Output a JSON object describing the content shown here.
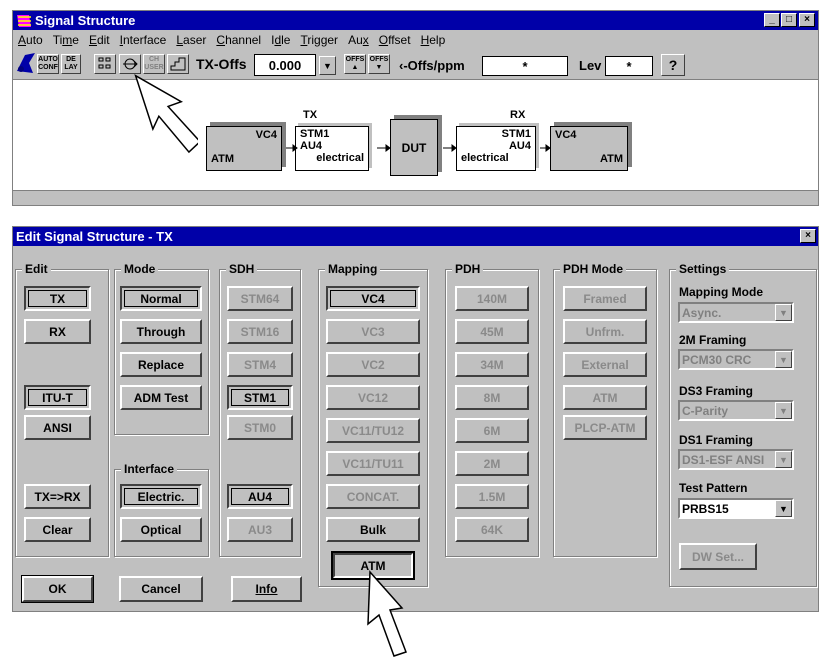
{
  "main_window": {
    "title": "Signal Structure",
    "min_btn": "_",
    "max_btn": "□",
    "close_btn": "×",
    "menu": [
      {
        "label": "Auto",
        "u": "A"
      },
      {
        "label": "Time",
        "u": "m"
      },
      {
        "label": "Edit",
        "u": "E"
      },
      {
        "label": "Interface",
        "u": "I"
      },
      {
        "label": "Laser",
        "u": "L"
      },
      {
        "label": "Channel",
        "u": "C"
      },
      {
        "label": "Idle",
        "u": "d"
      },
      {
        "label": "Trigger",
        "u": "T"
      },
      {
        "label": "Aux",
        "u": "x"
      },
      {
        "label": "Offset",
        "u": "O"
      },
      {
        "label": "Help",
        "u": "H"
      }
    ],
    "toolbar": {
      "auto_conf": "AUTO CONF",
      "delay": "DE LAY",
      "user_ch": "CH USER",
      "tx_offs_label": "TX-Offs",
      "tx_offs_value": "0.000",
      "offs_up": "OFFS ▲",
      "offs_down": "OFFS ▼",
      "offs_ppm_label": "‹-Offs/ppm",
      "offs_ppm_value": "*",
      "lev_label": "Lev",
      "lev_value": "*",
      "help_icon": "?"
    },
    "diagram": {
      "tx_label": "TX",
      "rx_label": "RX",
      "tx_atm": {
        "top": "VC4",
        "bottom": "ATM"
      },
      "tx_stm": {
        "l1": "STM1",
        "l2": "AU4",
        "l3": "electrical"
      },
      "dut": "DUT",
      "rx_stm": {
        "l1": "STM1",
        "l2": "AU4",
        "l3": "electrical"
      },
      "rx_atm": {
        "top": "VC4",
        "bottom": "ATM"
      }
    }
  },
  "dialog": {
    "title": "Edit Signal Structure - TX",
    "close": "×",
    "groups": {
      "edit": "Edit",
      "mode": "Mode",
      "sdh": "SDH",
      "mapping": "Mapping",
      "pdh": "PDH",
      "pdh_mode": "PDH Mode",
      "settings": "Settings",
      "interface": "Interface"
    },
    "edit": {
      "tx": "TX",
      "rx": "RX",
      "itu": "ITU-T",
      "ansi": "ANSI",
      "txrx": "TX=>RX",
      "clear": "Clear"
    },
    "mode": {
      "normal": "Normal",
      "through": "Through",
      "replace": "Replace",
      "adm": "ADM Test"
    },
    "interface": {
      "electric": "Electric.",
      "optical": "Optical"
    },
    "sdh": {
      "stm64": "STM64",
      "stm16": "STM16",
      "stm4": "STM4",
      "stm1": "STM1",
      "stm0": "STM0",
      "au4": "AU4",
      "au3": "AU3"
    },
    "mapping": {
      "vc4": "VC4",
      "vc3": "VC3",
      "vc2": "VC2",
      "vc12": "VC12",
      "vc11tu12": "VC11/TU12",
      "vc11tu11": "VC11/TU11",
      "concat": "CONCAT.",
      "bulk": "Bulk",
      "atm": "ATM"
    },
    "pdh": {
      "p140": "140M",
      "p45": "45M",
      "p34": "34M",
      "p8": "8M",
      "p6": "6M",
      "p2": "2M",
      "p15": "1.5M",
      "p64": "64K"
    },
    "pdh_mode": {
      "framed": "Framed",
      "unfrm": "Unfrm.",
      "external": "External",
      "atm": "ATM",
      "plcp": "PLCP-ATM"
    },
    "settings": {
      "mapping_mode_label": "Mapping Mode",
      "mapping_mode_value": "Async.",
      "framing_2m_label": "2M Framing",
      "framing_2m_value": "PCM30 CRC",
      "framing_ds3_label": "DS3 Framing",
      "framing_ds3_value": "C-Parity",
      "framing_ds1_label": "DS1 Framing",
      "framing_ds1_value": "DS1-ESF ANSI",
      "test_pattern_label": "Test Pattern",
      "test_pattern_value": "PRBS15",
      "dw_set": "DW Set..."
    },
    "footer": {
      "ok": "OK",
      "cancel": "Cancel",
      "info": "Info"
    }
  }
}
